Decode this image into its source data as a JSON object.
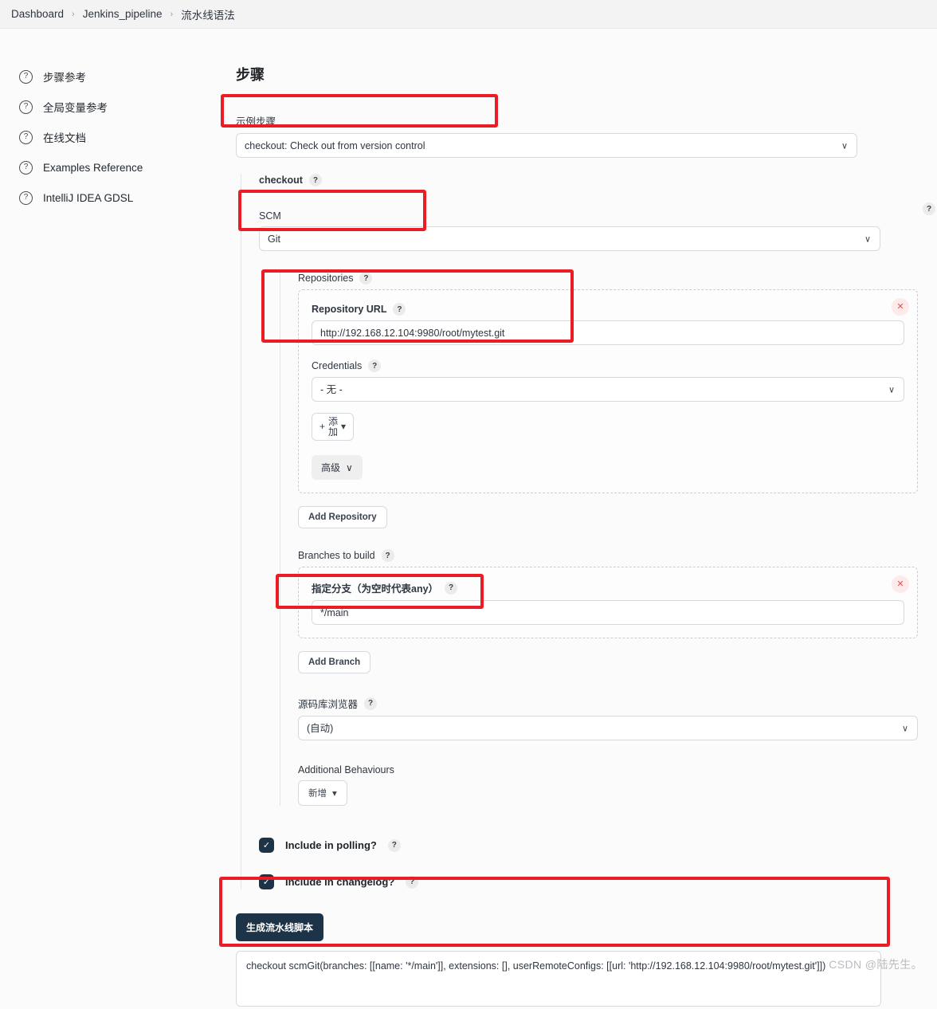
{
  "breadcrumb": {
    "items": [
      "Dashboard",
      "Jenkins_pipeline",
      "流水线语法"
    ],
    "separator": "›"
  },
  "sidebar": {
    "items": [
      {
        "label": "步骤参考",
        "icon": "help-circle-icon"
      },
      {
        "label": "全局变量参考",
        "icon": "help-circle-icon"
      },
      {
        "label": "在线文档",
        "icon": "help-circle-icon"
      },
      {
        "label": "Examples Reference",
        "icon": "help-circle-icon"
      },
      {
        "label": "IntelliJ IDEA GDSL",
        "icon": "help-circle-icon"
      }
    ]
  },
  "main": {
    "section_title": "步骤",
    "example_step": {
      "label": "示例步骤",
      "value": "checkout: Check out from version control",
      "caret": "∨"
    },
    "checkout": {
      "label": "checkout",
      "help": "?"
    },
    "scm": {
      "label": "SCM",
      "value": "Git",
      "caret": "∨",
      "right_help": "?"
    },
    "repositories": {
      "label": "Repositories",
      "help": "?",
      "repository_url": {
        "label": "Repository URL",
        "help": "?",
        "value": "http://192.168.12.104:9980/root/mytest.git",
        "placeholder": ""
      },
      "credentials": {
        "label": "Credentials",
        "help": "?",
        "value": "- 无 -",
        "caret": "∨"
      },
      "add_credentials_button": {
        "label": "添加",
        "plus": "+",
        "caret": "▾"
      },
      "advanced_button": {
        "label": "高级",
        "caret": "∨"
      },
      "delete_icon": "✕",
      "add_repository_button": "Add Repository"
    },
    "branches": {
      "label": "Branches to build",
      "help": "?",
      "branch_spec": {
        "label": "指定分支（为空时代表any）",
        "help": "?",
        "value": "*/main"
      },
      "delete_icon": "✕",
      "add_branch_button": "Add Branch"
    },
    "repo_browser": {
      "label": "源码库浏览器",
      "help": "?",
      "value": "(自动)",
      "caret": "∨"
    },
    "additional_behaviours": {
      "label": "Additional Behaviours",
      "add_button": "新增",
      "caret": "▾"
    },
    "checkboxes": [
      {
        "label": "Include in polling?",
        "checked": true,
        "help": "?",
        "mark": "✓"
      },
      {
        "label": "Include in changelog?",
        "checked": true,
        "help": "?",
        "mark": "✓"
      }
    ],
    "generate": {
      "button_label": "生成流水线脚本",
      "script_output": "checkout scmGit(branches: [[name: '*/main']], extensions: [], userRemoteConfigs: [[url: 'http://192.168.12.104:9980/root/mytest.git']])"
    }
  },
  "watermark": "CSDN @陆先生。",
  "colors": {
    "annotation": "#ec1c24",
    "primary": "#1d3448",
    "danger": "#e05252"
  }
}
